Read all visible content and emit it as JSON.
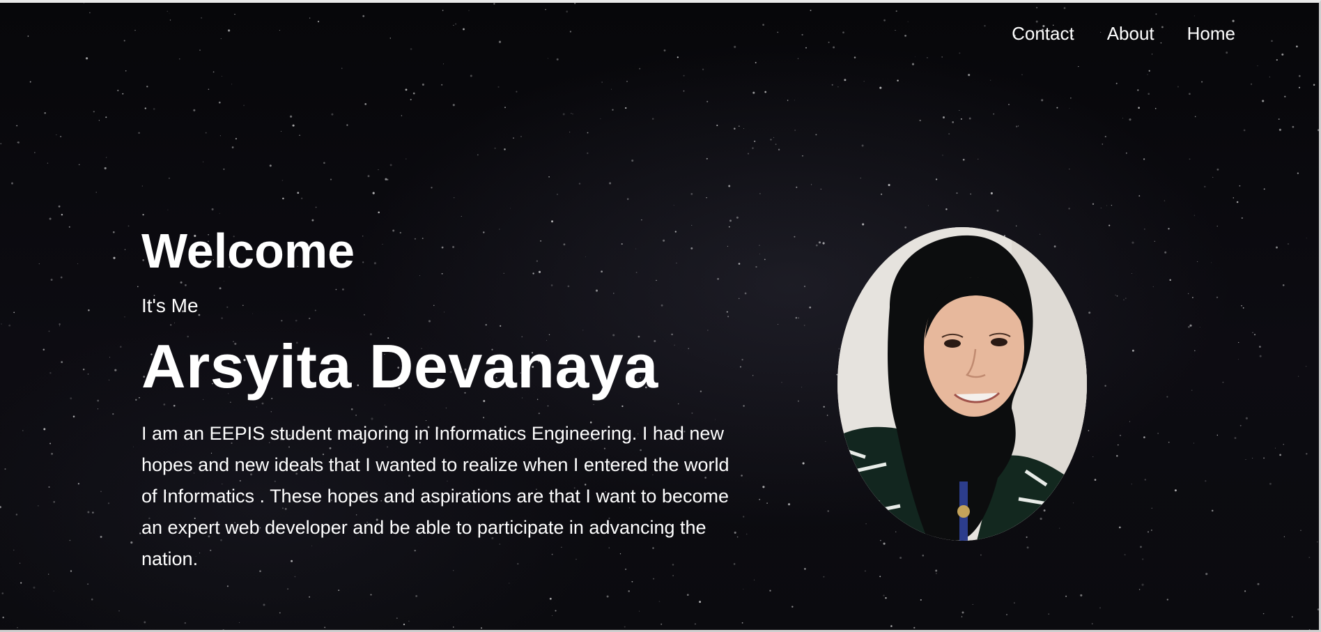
{
  "nav": {
    "items": [
      {
        "label": "Contact"
      },
      {
        "label": "About"
      },
      {
        "label": "Home"
      }
    ]
  },
  "hero": {
    "welcome": "Welcome",
    "intro": "It's Me",
    "name": "Arsyita Devanaya",
    "bio": "I am an EEPIS student majoring in Informatics Engineering. I had new hopes and new ideals that I wanted to realize when I entered the world of Informatics . These hopes and aspirations are that I want to become an expert web developer and be able to participate in advancing the nation."
  },
  "profile_photo": {
    "subject": "portrait of a smiling person wearing a black hijab",
    "shape": "oval"
  },
  "colors": {
    "background": "#0b0b0e",
    "text": "#ffffff",
    "photo_background": "#e6e3de"
  }
}
